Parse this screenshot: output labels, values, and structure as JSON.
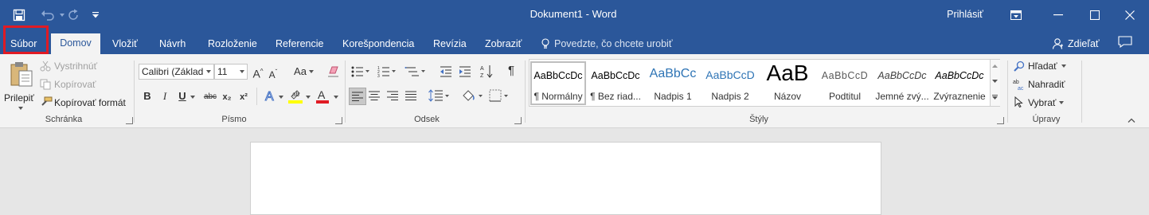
{
  "titlebar": {
    "title": "Dokument1  -  Word",
    "signin": "Prihlásiť",
    "icons": [
      "save-icon",
      "undo-icon",
      "redo-icon",
      "customize-qat-icon",
      "ribbon-display-icon",
      "minimize-icon",
      "maximize-icon",
      "close-icon"
    ]
  },
  "tabs": {
    "file": "Súbor",
    "home": "Domov",
    "insert": "Vložiť",
    "design": "Návrh",
    "layout": "Rozloženie",
    "references": "Referencie",
    "mailings": "Korešpondencia",
    "review": "Revízia",
    "view": "Zobraziť",
    "tellme": "Povedzte, čo chcete urobiť",
    "share": "Zdieľať"
  },
  "clipboard": {
    "label": "Schránka",
    "paste": "Prilepiť",
    "cut": "Vystrihnúť",
    "copy": "Kopírovať",
    "format_painter": "Kopírovať formát"
  },
  "font": {
    "label": "Písmo",
    "name": "Calibri (Základ",
    "size": "11",
    "case_label": "Aa",
    "bold": "B",
    "italic": "I",
    "underline": "U",
    "strike": "abc",
    "subscript": "x₂",
    "superscript": "x²",
    "grow": "A",
    "shrink": "A",
    "highlight_color": "#ffff00",
    "font_color": "#e01b24"
  },
  "paragraph": {
    "label": "Odsek",
    "pilcrow": "¶"
  },
  "styles": {
    "label": "Štýly",
    "items": [
      {
        "sample": "AaBbCcDc",
        "name": "¶ Normálny"
      },
      {
        "sample": "AaBbCcDc",
        "name": "¶ Bez riad..."
      },
      {
        "sample": "AaBbCc",
        "name": "Nadpis 1"
      },
      {
        "sample": "AaBbCcD",
        "name": "Nadpis 2"
      },
      {
        "sample": "AaB",
        "name": "Názov"
      },
      {
        "sample": "AaBbCcD",
        "name": "Podtitul"
      },
      {
        "sample": "AaBbCcDc",
        "name": "Jemné zvý..."
      },
      {
        "sample": "AaBbCcDc",
        "name": "Zvýraznenie"
      }
    ]
  },
  "editing": {
    "label": "Úpravy",
    "find": "Hľadať",
    "replace": "Nahradiť",
    "select": "Vybrať"
  },
  "colors": {
    "brand": "#2b579a",
    "ribbon": "#f3f3f3",
    "canvas": "#e6e6e6",
    "highlight_box": "#e01b24"
  }
}
